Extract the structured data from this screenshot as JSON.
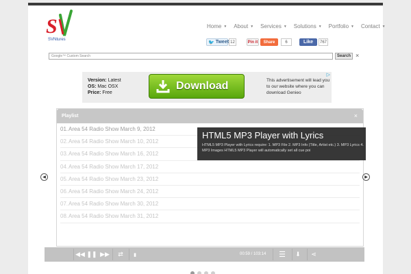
{
  "brand": {
    "logo_letters": "SV",
    "tagline": "SVNtures"
  },
  "nav": [
    {
      "label": "Home"
    },
    {
      "label": "About"
    },
    {
      "label": "Services"
    },
    {
      "label": "Solutions"
    },
    {
      "label": "Portfolio"
    },
    {
      "label": "Contact"
    }
  ],
  "share": {
    "tweet_label": "Tweet",
    "tweet_count": "12",
    "pin_label": "Pin it",
    "share_label": "Share",
    "share_count": "6",
    "like_label": "Like",
    "like_count": "767"
  },
  "search": {
    "placeholder": "Google™ Custom Search",
    "button_label": "Search",
    "clear_label": "×"
  },
  "ad": {
    "version_label": "Version:",
    "version_value": "Latest",
    "os_label": "OS:",
    "os_value": "Mac OSX",
    "price_label": "Price:",
    "price_value": "Free",
    "button_label": "Download",
    "text": "This advertisement will lead you to our website where you can download Genieo"
  },
  "player": {
    "header_label": "Playlist",
    "close_label": "×",
    "tracks": [
      {
        "num": "01.",
        "title": "Area 54 Radio Show March 9, 2012",
        "active": true
      },
      {
        "num": "02.",
        "title": "Area 54 Radio Show March 10, 2012",
        "active": false
      },
      {
        "num": "03.",
        "title": "Area 54 Radio Show March 16, 2012",
        "active": false
      },
      {
        "num": "04.",
        "title": "Area 54 Radio Show March 17, 2012",
        "active": false
      },
      {
        "num": "05.",
        "title": "Area 54 Radio Show March 23, 2012",
        "active": false
      },
      {
        "num": "06.",
        "title": "Area 54 Radio Show March 24, 2012",
        "active": false
      },
      {
        "num": "07.",
        "title": "Area 54 Radio Show March 30, 2012",
        "active": false
      },
      {
        "num": "08.",
        "title": "Area 54 Radio Show March 31, 2012",
        "active": false
      }
    ],
    "time": "00:59 / 103:14"
  },
  "slider": {
    "title": "HTML5 MP3 Player with Lyrics",
    "description": "HTML5 MP3 Player with Lyrics require: 1. MP3 File 2. MP3 Info (Title, Artist etc.) 3. MP3 Lyrics 4. MP3 Images HTML5 MP3 Player will automatically set all cue poi",
    "dots": [
      true,
      false,
      false,
      false
    ]
  },
  "colors": {
    "topbar": "#3a3a3a",
    "logo_red": "#d9202b",
    "logo_green": "#3aa535",
    "download_green": "#6fbf1a",
    "player_grey": "#c2c2c2"
  }
}
